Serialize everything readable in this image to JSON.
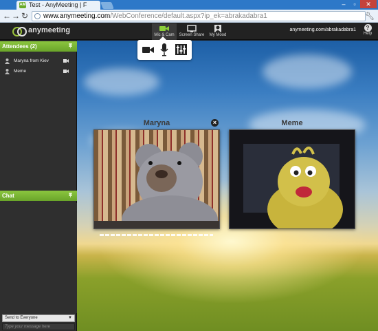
{
  "browser": {
    "tab_title": "Test - AnyMeeting | F",
    "tab_favicon": "AM",
    "url_host": "www.anymeeting.com",
    "url_path": "/WebConference/default.aspx?ip_ek=abrakadabra1"
  },
  "appbar": {
    "logo_text": "anymeeting",
    "tools": [
      {
        "label": "Mic & Cam",
        "icon": "camera-icon",
        "active": true
      },
      {
        "label": "Screen Share",
        "icon": "monitor-icon",
        "active": false
      },
      {
        "label": "My Mood",
        "icon": "person-icon",
        "active": false
      }
    ],
    "meeting_url": "anymeeting.com/abrakadabra1",
    "help_label": "Help",
    "help_glyph": "?"
  },
  "sidebar": {
    "attendees_header": "Attendees (2)",
    "attendees": [
      {
        "name": "Maryna from Kiev",
        "icon": "person-icon",
        "cam_icon": "camera-icon"
      },
      {
        "name": "Meme",
        "icon": "person-icon",
        "cam_icon": "camera-icon"
      }
    ],
    "chat_header": "Chat",
    "send_to": "Send to Everyone",
    "chat_placeholder": "Type your message here"
  },
  "mic_popover": {
    "icons": [
      "camera-icon",
      "microphone-icon",
      "settings-sliders-icon"
    ]
  },
  "videos": [
    {
      "name": "Maryna"
    },
    {
      "name": "Meme"
    }
  ],
  "colors": {
    "accent_green": "#7ab733",
    "appbar_bg": "#222222",
    "sidebar_bg": "#2f2f2f"
  }
}
